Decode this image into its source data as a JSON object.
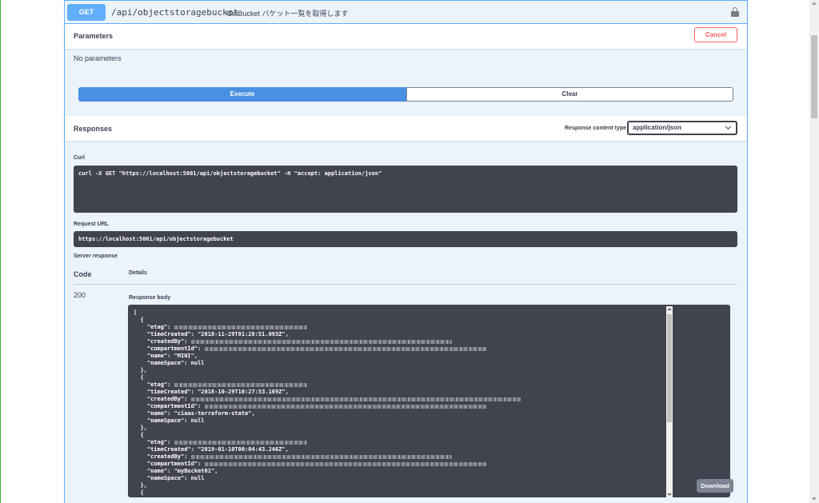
{
  "summary": {
    "method": "GET",
    "path": "/api/objectstoragebucket",
    "description": "GetBucket バケット一覧を取得します"
  },
  "parameters": {
    "title": "Parameters",
    "cancel_label": "Cancel",
    "empty_text": "No parameters"
  },
  "actions": {
    "execute_label": "Execute",
    "clear_label": "Clear"
  },
  "responses": {
    "title": "Responses",
    "content_type_label": "Response content type",
    "content_type_value": "application/json"
  },
  "curl": {
    "label": "Curl",
    "command": "curl -X GET \"https://localhost:5001/api/objectstoragebucket\" -H \"accept: application/json\""
  },
  "request_url": {
    "label": "Request URL",
    "value": "https://localhost:5001/api/objectstoragebucket"
  },
  "server_response": {
    "label": "Server response",
    "code_header": "Code",
    "details_header": "Details",
    "code": "200",
    "body_label": "Response body",
    "download_label": "Download"
  },
  "response_body": {
    "open_bracket": "[",
    "buckets": [
      {
        "open": "{",
        "etag_key": "\"etag\": ",
        "time_line": "\"timeCreated\": \"2018-11-29T01:28:51.093Z\",",
        "created_by_key": "\"createdBy\": ",
        "compartment_key": "\"compartmentId\": ",
        "name_line": "\"name\": \"MINI\",",
        "namespace_line": "\"nameSpace\": null",
        "close": "},"
      },
      {
        "open": "{",
        "etag_key": "\"etag\": ",
        "time_line": "\"timeCreated\": \"2018-10-29T10:27:53.169Z\",",
        "created_by_key": "\"createdBy\": ",
        "compartment_key": "\"compartmentId\": ",
        "name_line": "\"name\": \"ciaas-terraform-state\",",
        "namespace_line": "\"nameSpace\": null",
        "close": "},"
      },
      {
        "open": "{",
        "etag_key": "\"etag\": ",
        "time_line": "\"timeCreated\": \"2019-01-10T00:04:43.246Z\",",
        "created_by_key": "\"createdBy\": ",
        "compartment_key": "\"compartmentId\": ",
        "name_line": "\"name\": \"myBucket01\",",
        "namespace_line": "\"nameSpace\": null",
        "close": "},"
      }
    ],
    "trailing_open": "{"
  }
}
